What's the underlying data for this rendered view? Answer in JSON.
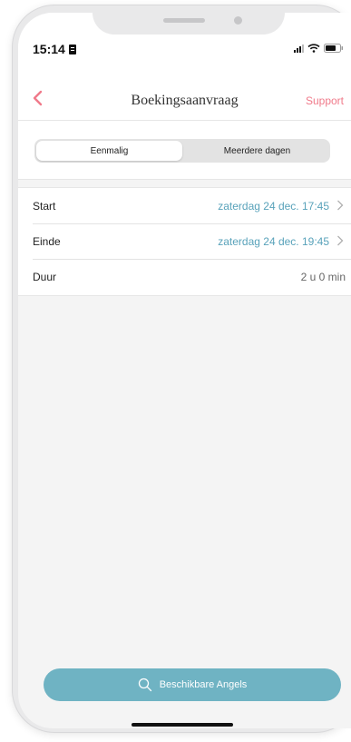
{
  "status": {
    "time": "15:14"
  },
  "nav": {
    "title": "Boekingsaanvraag",
    "support_label": "Support"
  },
  "segments": [
    {
      "label": "Eenmalig",
      "active": true
    },
    {
      "label": "Meerdere dagen",
      "active": false
    }
  ],
  "details": {
    "start": {
      "label": "Start",
      "value": "zaterdag 24 dec. 17:45"
    },
    "end": {
      "label": "Einde",
      "value": "zaterdag 24 dec. 19:45"
    },
    "duration": {
      "label": "Duur",
      "value": "2 u 0 min"
    }
  },
  "search_button": {
    "label": "Beschikbare Angels",
    "icon": "search-icon"
  },
  "colors": {
    "accent_pink": "#f07a8a",
    "link_blue": "#58a2ba",
    "button_teal": "#6fb3c3"
  }
}
